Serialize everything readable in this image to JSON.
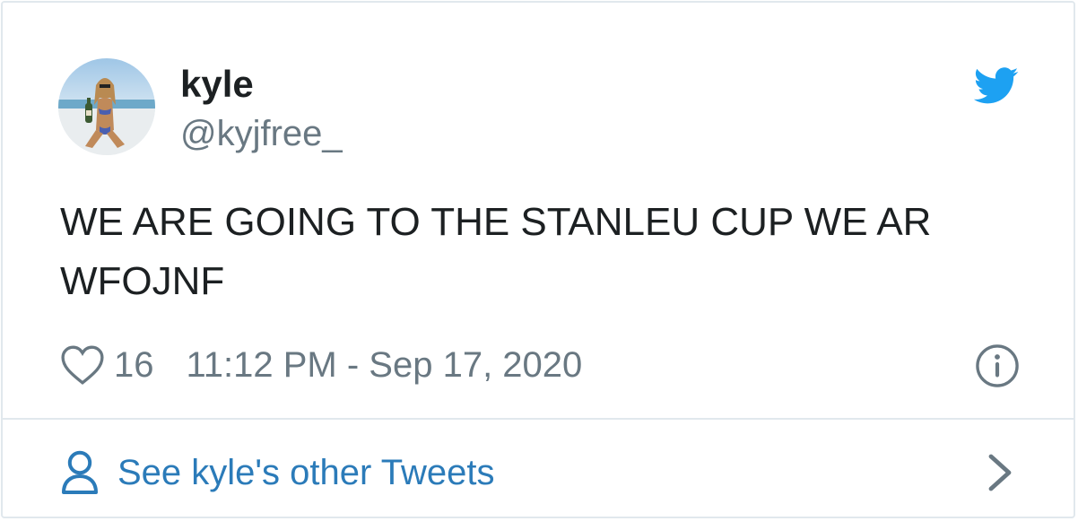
{
  "author": {
    "name": "kyle",
    "handle": "@kyjfree_"
  },
  "tweet": {
    "text": "WE ARE GOING TO THE STANLEU CUP WE AR WFOJNF",
    "likes": "16",
    "timestamp": "11:12 PM - Sep 17, 2020"
  },
  "footer": {
    "see_other_label": "See kyle's other Tweets"
  },
  "icons": {
    "brand": "twitter-bird-icon",
    "like": "heart-icon",
    "info": "info-icon",
    "profile": "person-icon",
    "next": "chevron-right-icon"
  },
  "colors": {
    "twitter_blue": "#1da1f2",
    "link_blue": "#2b7bb9",
    "text": "#1c2022",
    "muted": "#697882",
    "border": "#e1e8ed"
  }
}
